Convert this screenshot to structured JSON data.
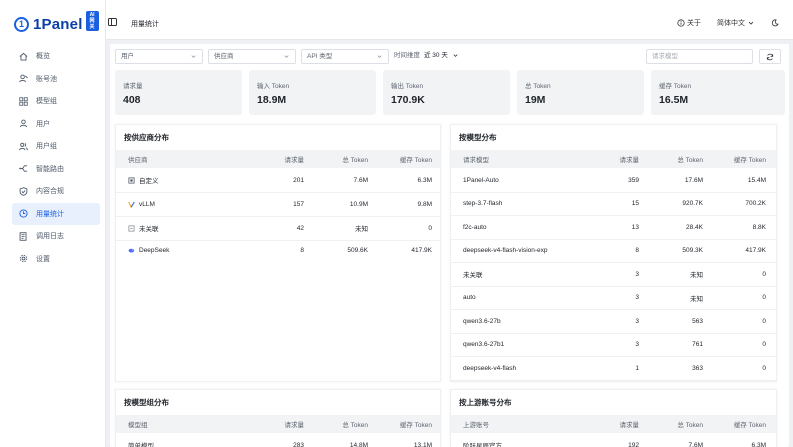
{
  "app": {
    "logo_text": "1Panel",
    "logo_badge_line1": "AI",
    "logo_badge_line2": "网关"
  },
  "sidebar": {
    "items": [
      {
        "label": "概览",
        "icon": "home-icon",
        "active": false
      },
      {
        "label": "账号池",
        "icon": "users-icon",
        "active": false
      },
      {
        "label": "模型组",
        "icon": "cube-group-icon",
        "active": false
      },
      {
        "label": "用户",
        "icon": "user-icon",
        "active": false
      },
      {
        "label": "用户组",
        "icon": "user-group-icon",
        "active": false
      },
      {
        "label": "智能路由",
        "icon": "route-icon",
        "active": false
      },
      {
        "label": "内容合规",
        "icon": "shield-icon",
        "active": false
      },
      {
        "label": "用量统计",
        "icon": "clock-stats-icon",
        "active": true
      },
      {
        "label": "调用日志",
        "icon": "log-icon",
        "active": false
      },
      {
        "label": "设置",
        "icon": "gear-icon",
        "active": false
      }
    ]
  },
  "topbar": {
    "title": "用量统计",
    "about": "关于",
    "language": "简体中文",
    "accent": "#1a5fe0"
  },
  "filters": {
    "user": "用户",
    "provider": "供应商",
    "api_type": "API 类型",
    "time_label": "时间维度",
    "time_value": "近 30 天",
    "search_placeholder": "请求模型"
  },
  "stats": [
    {
      "label": "请求量",
      "value": "408"
    },
    {
      "label": "输入 Token",
      "value": "18.9M"
    },
    {
      "label": "输出 Token",
      "value": "170.9K"
    },
    {
      "label": "总 Token",
      "value": "19M"
    },
    {
      "label": "缓存 Token",
      "value": "16.5M"
    }
  ],
  "by_provider": {
    "title": "按供应商分布",
    "headers": [
      "供应商",
      "请求量",
      "总 Token",
      "缓存 Token"
    ],
    "rows": [
      {
        "name": "自定义",
        "icon": "custom-provider-icon",
        "requests": "201",
        "total": "7.6M",
        "cache": "6.3M"
      },
      {
        "name": "vLLM",
        "icon": "vllm-icon",
        "requests": "157",
        "total": "10.9M",
        "cache": "9.8M"
      },
      {
        "name": "未关联",
        "icon": "unlinked-icon",
        "requests": "42",
        "total": "未知",
        "cache": "0"
      },
      {
        "name": "DeepSeek",
        "icon": "deepseek-icon",
        "requests": "8",
        "total": "509.6K",
        "cache": "417.9K"
      }
    ]
  },
  "by_model": {
    "title": "按模型分布",
    "headers": [
      "请求模型",
      "请求量",
      "总 Token",
      "缓存 Token"
    ],
    "rows": [
      {
        "name": "1Panel-Auto",
        "requests": "359",
        "total": "17.6M",
        "cache": "15.4M"
      },
      {
        "name": "step-3.7-flash",
        "requests": "15",
        "total": "920.7K",
        "cache": "700.2K"
      },
      {
        "name": "f2c-auto",
        "requests": "13",
        "total": "28.4K",
        "cache": "8.8K"
      },
      {
        "name": "deepseek-v4-flash-vision-exp",
        "requests": "8",
        "total": "509.3K",
        "cache": "417.9K"
      },
      {
        "name": "未关联",
        "requests": "3",
        "total": "未知",
        "cache": "0"
      },
      {
        "name": "auto",
        "requests": "3",
        "total": "未知",
        "cache": "0"
      },
      {
        "name": "qwen3.6-27b",
        "requests": "3",
        "total": "563",
        "cache": "0"
      },
      {
        "name": "qwen3.6-27b1",
        "requests": "3",
        "total": "761",
        "cache": "0"
      },
      {
        "name": "deepseek-v4-flash",
        "requests": "1",
        "total": "363",
        "cache": "0"
      }
    ]
  },
  "by_model_group": {
    "title": "按模型组分布",
    "headers": [
      "模型组",
      "请求量",
      "总 Token",
      "缓存 Token"
    ],
    "rows": [
      {
        "name": "简单模型",
        "requests": "283",
        "total": "14.8M",
        "cache": "13.1M"
      }
    ]
  },
  "by_upstream": {
    "title": "按上游账号分布",
    "headers": [
      "上游账号",
      "请求量",
      "总 Token",
      "缓存 Token"
    ],
    "rows": [
      {
        "name": "阶跃星辰官方",
        "requests": "192",
        "total": "7.6M",
        "cache": "6.3M"
      }
    ]
  }
}
